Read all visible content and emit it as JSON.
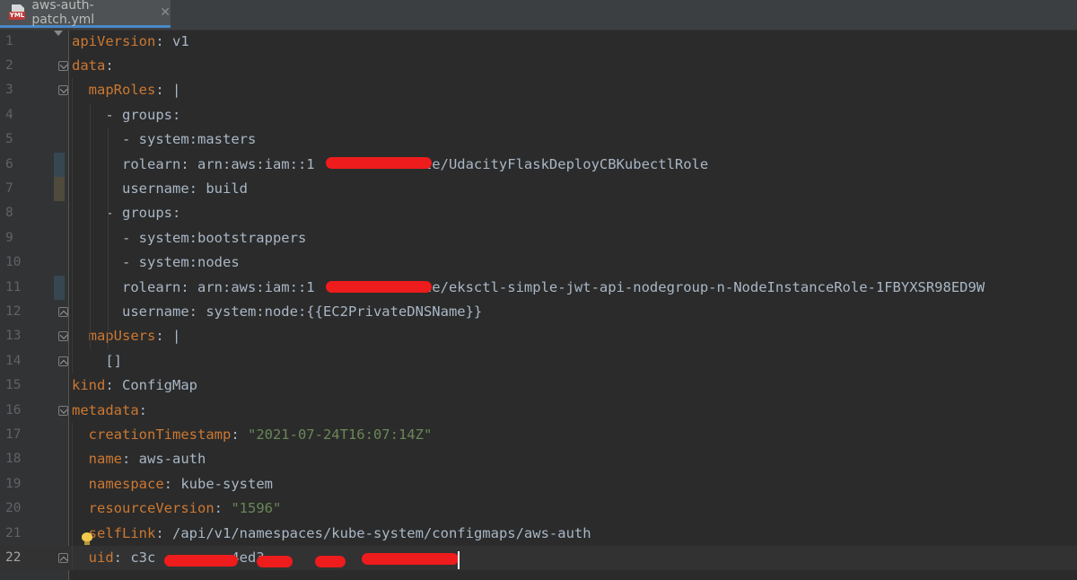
{
  "tab": {
    "file_icon_badge": "YML",
    "file_name": "aws-auth-patch.yml",
    "close_glyph": "✕"
  },
  "colors": {
    "background": "#2b2b2b",
    "gutter": "#313335",
    "key": "#cc7832",
    "string": "#6a8759",
    "text": "#a9b7c6",
    "redaction": "#ee1c1c"
  },
  "lines": [
    {
      "n": "1",
      "indent": "",
      "key": "apiVersion",
      "sep": ": ",
      "value": "v1"
    },
    {
      "n": "2",
      "indent": "",
      "key": "data",
      "sep": ":",
      "value": ""
    },
    {
      "n": "3",
      "indent": "  ",
      "key": "mapRoles",
      "sep": ": ",
      "value": "|"
    },
    {
      "n": "4",
      "indent": "    ",
      "key": "",
      "sep": "",
      "value": "- groups:"
    },
    {
      "n": "5",
      "indent": "      ",
      "key": "",
      "sep": "",
      "value": "- system:masters"
    },
    {
      "n": "6",
      "indent": "      ",
      "key": "",
      "sep": "",
      "value": "rolearn: arn:aws:iam::1          :role/UdacityFlaskDeployCBKubectlRole"
    },
    {
      "n": "7",
      "indent": "      ",
      "key": "",
      "sep": "",
      "value": "username: build"
    },
    {
      "n": "8",
      "indent": "    ",
      "key": "",
      "sep": "",
      "value": "- groups:"
    },
    {
      "n": "9",
      "indent": "      ",
      "key": "",
      "sep": "",
      "value": "- system:bootstrappers"
    },
    {
      "n": "10",
      "indent": "      ",
      "key": "",
      "sep": "",
      "value": "- system:nodes"
    },
    {
      "n": "11",
      "indent": "      ",
      "key": "",
      "sep": "",
      "value": "rolearn: arn:aws:iam::1          :role/eksctl-simple-jwt-api-nodegroup-n-NodeInstanceRole-1FBYXSR98ED9W"
    },
    {
      "n": "12",
      "indent": "      ",
      "key": "",
      "sep": "",
      "value": "username: system:node:{{EC2PrivateDNSName}}"
    },
    {
      "n": "13",
      "indent": "  ",
      "key": "mapUsers",
      "sep": ": ",
      "value": "|"
    },
    {
      "n": "14",
      "indent": "    ",
      "key": "",
      "sep": "",
      "value": "[]"
    },
    {
      "n": "15",
      "indent": "",
      "key": "kind",
      "sep": ": ",
      "value": "ConfigMap"
    },
    {
      "n": "16",
      "indent": "",
      "key": "metadata",
      "sep": ":",
      "value": ""
    },
    {
      "n": "17",
      "indent": "  ",
      "key": "creationTimestamp",
      "sep": ": ",
      "value": "\"2021-07-24T16:07:14Z\"",
      "value_is_string": true
    },
    {
      "n": "18",
      "indent": "  ",
      "key": "name",
      "sep": ": ",
      "value": "aws-auth"
    },
    {
      "n": "19",
      "indent": "  ",
      "key": "namespace",
      "sep": ": ",
      "value": "kube-system"
    },
    {
      "n": "20",
      "indent": "  ",
      "key": "resourceVersion",
      "sep": ": ",
      "value": "\"1596\"",
      "value_is_string": true
    },
    {
      "n": "21",
      "indent": "  ",
      "key": "selfLink",
      "sep": ": ",
      "value": "/api/v1/namespaces/kube-system/configmaps/aws-auth"
    },
    {
      "n": "22",
      "indent": "  ",
      "key": "uid",
      "sep": ": ",
      "value": "c3c        -4ed3-         "
    }
  ]
}
